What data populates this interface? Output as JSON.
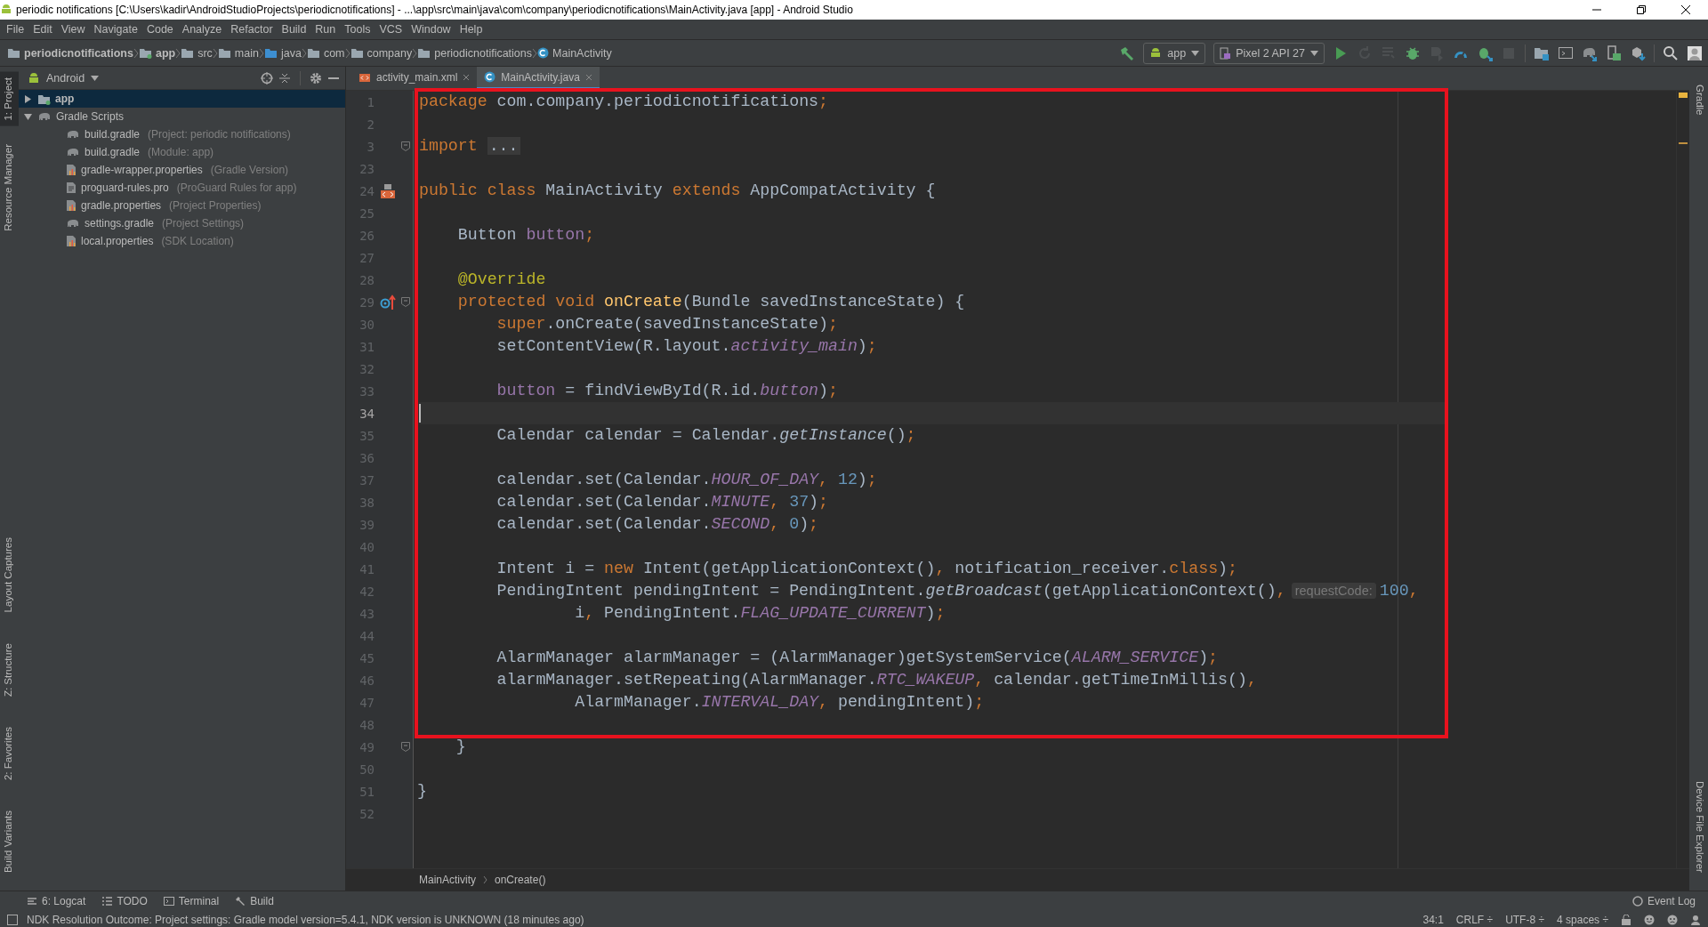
{
  "window": {
    "title": "periodic notifications [C:\\Users\\kadir\\AndroidStudioProjects\\periodicnotifications] - ...\\app\\src\\main\\java\\com\\company\\periodicnotifications\\MainActivity.java [app] - Android Studio"
  },
  "menu": [
    "File",
    "Edit",
    "View",
    "Navigate",
    "Code",
    "Analyze",
    "Refactor",
    "Build",
    "Run",
    "Tools",
    "VCS",
    "Window",
    "Help"
  ],
  "breadcrumbs": [
    {
      "label": "periodicnotifications",
      "kind": "project"
    },
    {
      "label": "app",
      "kind": "module"
    },
    {
      "label": "src",
      "kind": "folder"
    },
    {
      "label": "main",
      "kind": "folder"
    },
    {
      "label": "java",
      "kind": "source"
    },
    {
      "label": "com",
      "kind": "folder"
    },
    {
      "label": "company",
      "kind": "folder"
    },
    {
      "label": "periodicnotifications",
      "kind": "folder"
    },
    {
      "label": "MainActivity",
      "kind": "class"
    }
  ],
  "toolbar": {
    "run_config": "app",
    "device": "Pixel 2 API 27",
    "buttons": [
      {
        "disabled": false
      },
      {
        "disabled": true
      },
      {
        "disabled": true
      },
      {
        "disabled": false
      },
      {
        "disabled": true
      },
      {
        "disabled": false
      },
      {
        "disabled": false
      },
      {
        "disabled": true
      },
      {
        "disabled": false
      },
      {
        "disabled": false
      },
      {
        "disabled": false
      },
      {
        "disabled": false
      },
      {
        "disabled": false
      },
      {
        "disabled": false
      },
      {
        "disabled": false
      }
    ]
  },
  "left_tool_windows": {
    "top": [
      {
        "label": "1: Project",
        "selected": true
      },
      {
        "label": "Resource Manager",
        "selected": false
      }
    ],
    "bottom": [
      {
        "label": "Layout Captures",
        "selected": false
      },
      {
        "label": "Z: Structure",
        "selected": false
      },
      {
        "label": "2: Favorites",
        "selected": false
      },
      {
        "label": "Build Variants",
        "selected": false
      }
    ]
  },
  "right_tool_windows": {
    "top": [
      {
        "label": "Gradle"
      }
    ],
    "bottom": [
      {
        "label": "Device File Explorer"
      }
    ]
  },
  "project": {
    "view": "Android",
    "tree": [
      {
        "name": "app",
        "kind": "module",
        "selected": true,
        "expanded": false
      },
      {
        "name": "Gradle Scripts",
        "kind": "gradle",
        "selected": false,
        "expanded": true,
        "children": [
          {
            "name": "build.gradle",
            "detail": "(Project: periodic notifications)",
            "kind": "gradle",
            "selected": false
          },
          {
            "name": "build.gradle",
            "detail": "(Module: app)",
            "kind": "gradle",
            "selected": false
          },
          {
            "name": "gradle-wrapper.properties",
            "detail": "(Gradle Version)",
            "kind": "properties",
            "selected": false
          },
          {
            "name": "proguard-rules.pro",
            "detail": "(ProGuard Rules for app)",
            "kind": "text",
            "selected": false
          },
          {
            "name": "gradle.properties",
            "detail": "(Project Properties)",
            "kind": "properties",
            "selected": false
          },
          {
            "name": "settings.gradle",
            "detail": "(Project Settings)",
            "kind": "gradle",
            "selected": false
          },
          {
            "name": "local.properties",
            "detail": "(SDK Location)",
            "kind": "properties",
            "selected": false
          }
        ]
      }
    ]
  },
  "editor": {
    "tabs": [
      {
        "label": "activity_main.xml",
        "kind": "xml",
        "selected": false
      },
      {
        "label": "MainActivity.java",
        "kind": "class",
        "selected": true
      }
    ],
    "lines": [
      {
        "number": "1",
        "highlighted": true,
        "tokens": [
          {
            "kind": "keyword",
            "text": "package"
          },
          {
            "kind": "plain",
            "text": " com.company.periodicnotifications"
          },
          {
            "kind": "keyword",
            "text": ";"
          }
        ]
      },
      {
        "number": "2",
        "highlighted": true
      },
      {
        "number": "3",
        "highlighted": true,
        "fold": true,
        "tokens": [
          {
            "kind": "keyword",
            "text": "import "
          },
          {
            "kind": "folded",
            "text": "..."
          }
        ]
      },
      {
        "number": "23",
        "highlighted": true
      },
      {
        "number": "24",
        "highlighted": true,
        "gutter": {
          "kind": "class"
        },
        "tokens": [
          {
            "kind": "keyword",
            "text": "public class"
          },
          {
            "kind": "plain",
            "text": " MainActivity "
          },
          {
            "kind": "keyword",
            "text": "extends"
          },
          {
            "kind": "plain",
            "text": " AppCompatActivity {"
          }
        ]
      },
      {
        "number": "25",
        "highlighted": true
      },
      {
        "number": "26",
        "highlighted": true,
        "tokens": [
          {
            "kind": "plain",
            "text": "    Button "
          },
          {
            "kind": "field",
            "text": "button"
          },
          {
            "kind": "keyword",
            "text": ";"
          }
        ]
      },
      {
        "number": "27",
        "highlighted": true
      },
      {
        "number": "28",
        "highlighted": true,
        "tokens": [
          {
            "kind": "annotation",
            "text": "    @Override"
          }
        ]
      },
      {
        "number": "29",
        "highlighted": true,
        "fold": true,
        "gutter": {
          "kind": "override"
        },
        "tokens": [
          {
            "kind": "keyword",
            "text": "    protected void "
          },
          {
            "kind": "method",
            "text": "onCreate"
          },
          {
            "kind": "plain",
            "text": "(Bundle savedInstanceState) {"
          }
        ]
      },
      {
        "number": "30",
        "highlighted": true,
        "tokens": [
          {
            "kind": "keyword",
            "text": "        super"
          },
          {
            "kind": "plain",
            "text": ".onCreate(savedInstanceState)"
          },
          {
            "kind": "keyword",
            "text": ";"
          }
        ]
      },
      {
        "number": "31",
        "highlighted": true,
        "tokens": [
          {
            "kind": "plain",
            "text": "        setContentView(R.layout."
          },
          {
            "kind": "static",
            "text": "activity_main"
          },
          {
            "kind": "plain",
            "text": ")"
          },
          {
            "kind": "keyword",
            "text": ";"
          }
        ]
      },
      {
        "number": "32",
        "highlighted": true
      },
      {
        "number": "33",
        "highlighted": true,
        "tokens": [
          {
            "kind": "field",
            "text": "        button"
          },
          {
            "kind": "plain",
            "text": " = findViewById(R.id."
          },
          {
            "kind": "static",
            "text": "button"
          },
          {
            "kind": "plain",
            "text": ")"
          },
          {
            "kind": "keyword",
            "text": ";"
          }
        ]
      },
      {
        "number": "34",
        "highlighted": true,
        "current": true
      },
      {
        "number": "35",
        "highlighted": true,
        "tokens": [
          {
            "kind": "plain",
            "text": "        Calendar calendar = Calendar."
          },
          {
            "kind": "static_call",
            "text": "getInstance"
          },
          {
            "kind": "plain",
            "text": "()"
          },
          {
            "kind": "keyword",
            "text": ";"
          }
        ]
      },
      {
        "number": "36",
        "highlighted": true
      },
      {
        "number": "37",
        "highlighted": true,
        "tokens": [
          {
            "kind": "plain",
            "text": "        calendar.set(Calendar."
          },
          {
            "kind": "static",
            "text": "HOUR_OF_DAY"
          },
          {
            "kind": "keyword",
            "text": ", "
          },
          {
            "kind": "number",
            "text": "12"
          },
          {
            "kind": "plain",
            "text": ")"
          },
          {
            "kind": "keyword",
            "text": ";"
          }
        ]
      },
      {
        "number": "38",
        "highlighted": true,
        "tokens": [
          {
            "kind": "plain",
            "text": "        calendar.set(Calendar."
          },
          {
            "kind": "static",
            "text": "MINUTE"
          },
          {
            "kind": "keyword",
            "text": ", "
          },
          {
            "kind": "number",
            "text": "37"
          },
          {
            "kind": "plain",
            "text": ")"
          },
          {
            "kind": "keyword",
            "text": ";"
          }
        ]
      },
      {
        "number": "39",
        "highlighted": true,
        "tokens": [
          {
            "kind": "plain",
            "text": "        calendar.set(Calendar."
          },
          {
            "kind": "static",
            "text": "SECOND"
          },
          {
            "kind": "keyword",
            "text": ", "
          },
          {
            "kind": "number",
            "text": "0"
          },
          {
            "kind": "plain",
            "text": ")"
          },
          {
            "kind": "keyword",
            "text": ";"
          }
        ]
      },
      {
        "number": "40",
        "highlighted": true
      },
      {
        "number": "41",
        "highlighted": true,
        "tokens": [
          {
            "kind": "plain",
            "text": "        Intent i = "
          },
          {
            "kind": "keyword",
            "text": "new"
          },
          {
            "kind": "plain",
            "text": " Intent(getApplicationContext()"
          },
          {
            "kind": "keyword",
            "text": ","
          },
          {
            "kind": "plain",
            "text": " notification_receiver."
          },
          {
            "kind": "keyword",
            "text": "class"
          },
          {
            "kind": "plain",
            "text": ")"
          },
          {
            "kind": "keyword",
            "text": ";"
          }
        ]
      },
      {
        "number": "42",
        "highlighted": true,
        "tokens": [
          {
            "kind": "plain",
            "text": "        PendingIntent pendingIntent = PendingIntent."
          },
          {
            "kind": "static_call",
            "text": "getBroadcast"
          },
          {
            "kind": "plain",
            "text": "(getApplicationContext()"
          },
          {
            "kind": "keyword",
            "text": ","
          },
          {
            "kind": "hint",
            "text": "requestCode:"
          },
          {
            "kind": "number",
            "text": "100"
          },
          {
            "kind": "keyword",
            "text": ","
          }
        ]
      },
      {
        "number": "43",
        "highlighted": true,
        "tokens": [
          {
            "kind": "plain",
            "text": "                i"
          },
          {
            "kind": "keyword",
            "text": ","
          },
          {
            "kind": "plain",
            "text": " PendingIntent."
          },
          {
            "kind": "static",
            "text": "FLAG_UPDATE_CURRENT"
          },
          {
            "kind": "plain",
            "text": ")"
          },
          {
            "kind": "keyword",
            "text": ";"
          }
        ]
      },
      {
        "number": "44",
        "highlighted": true
      },
      {
        "number": "45",
        "highlighted": true,
        "tokens": [
          {
            "kind": "plain",
            "text": "        AlarmManager alarmManager = (AlarmManager)getSystemService("
          },
          {
            "kind": "static",
            "text": "ALARM_SERVICE"
          },
          {
            "kind": "plain",
            "text": ")"
          },
          {
            "kind": "keyword",
            "text": ";"
          }
        ]
      },
      {
        "number": "46",
        "highlighted": true,
        "tokens": [
          {
            "kind": "plain",
            "text": "        alarmManager.setRepeating(AlarmManager."
          },
          {
            "kind": "static",
            "text": "RTC_WAKEUP"
          },
          {
            "kind": "keyword",
            "text": ","
          },
          {
            "kind": "plain",
            "text": " calendar.getTimeInMillis()"
          },
          {
            "kind": "keyword",
            "text": ","
          }
        ]
      },
      {
        "number": "47",
        "highlighted": true,
        "tokens": [
          {
            "kind": "plain",
            "text": "                AlarmManager."
          },
          {
            "kind": "static",
            "text": "INTERVAL_DAY"
          },
          {
            "kind": "keyword",
            "text": ","
          },
          {
            "kind": "plain",
            "text": " pendingIntent)"
          },
          {
            "kind": "keyword",
            "text": ";"
          }
        ]
      },
      {
        "number": "48",
        "highlighted": true
      },
      {
        "number": "49",
        "fold": true,
        "tokens": [
          {
            "kind": "plain",
            "text": "    }"
          }
        ]
      },
      {
        "number": "50"
      },
      {
        "number": "51",
        "tokens": [
          {
            "kind": "plain",
            "text": "}"
          }
        ]
      },
      {
        "number": "52"
      }
    ],
    "breadcrumbs": [
      "MainActivity",
      "onCreate()"
    ]
  },
  "bottom_tool_windows": [
    {
      "label": "6: Logcat",
      "kind": "logcat"
    },
    {
      "label": "TODO",
      "kind": "todo"
    },
    {
      "label": "Terminal",
      "kind": "terminal"
    },
    {
      "label": "Build",
      "kind": "build"
    }
  ],
  "event_log": "Event Log",
  "status_bar": {
    "message": "NDK Resolution Outcome: Project settings: Gradle model version=5.4.1, NDK version is UNKNOWN (18 minutes ago)",
    "position": "34:1",
    "line_separator": "CRLF ÷",
    "encoding": "UTF-8 ÷",
    "indent": "4 spaces ÷"
  }
}
